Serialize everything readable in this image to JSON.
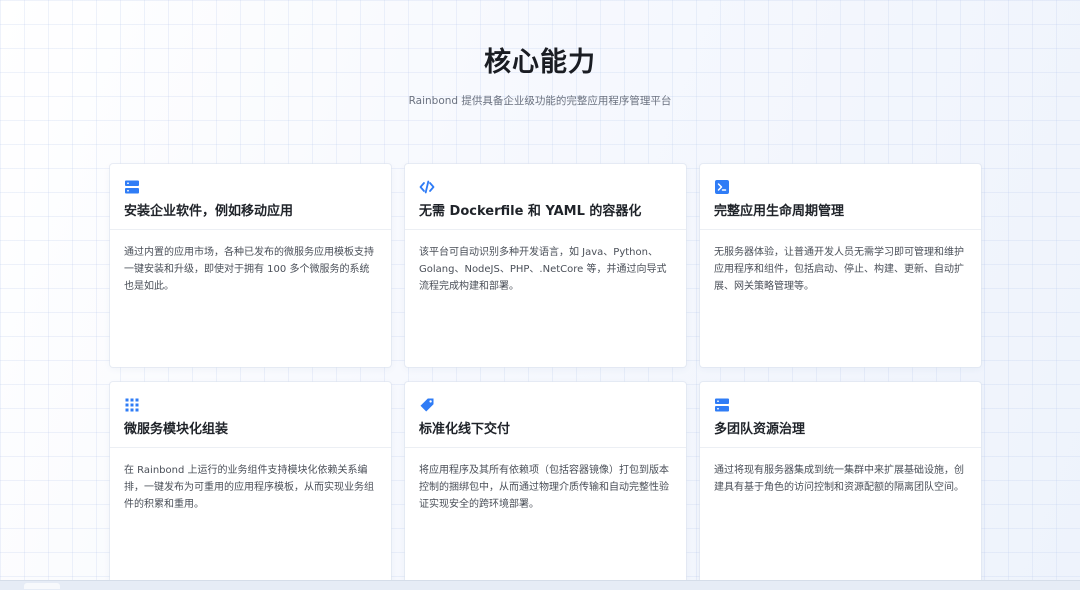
{
  "header": {
    "title": "核心能力",
    "subtitle": "Rainbond 提供具备企业级功能的完整应用程序管理平台"
  },
  "colors": {
    "accent": "#2f7cf6",
    "title_text": "#1a1d23",
    "body_text": "#4a4f58",
    "subtitle_text": "#6b7280"
  },
  "features": [
    {
      "icon": "server-icon",
      "title": "安装企业软件，例如移动应用",
      "description": "通过内置的应用市场，各种已发布的微服务应用模板支持一键安装和升级，即使对于拥有 100 多个微服务的系统也是如此。"
    },
    {
      "icon": "code-icon",
      "title": "无需 Dockerfile 和 YAML 的容器化",
      "description": "该平台可自动识别多种开发语言，如 Java、Python、Golang、NodeJS、PHP、.NetCore 等，并通过向导式流程完成构建和部署。"
    },
    {
      "icon": "terminal-icon",
      "title": "完整应用生命周期管理",
      "description": "无服务器体验，让普通开发人员无需学习即可管理和维护应用程序和组件，包括启动、停止、构建、更新、自动扩展、网关策略管理等。"
    },
    {
      "icon": "grid-icon",
      "title": "微服务模块化组装",
      "description": "在 Rainbond 上运行的业务组件支持模块化依赖关系编排，一键发布为可重用的应用程序模板，从而实现业务组件的积累和重用。"
    },
    {
      "icon": "tag-icon",
      "title": "标准化线下交付",
      "description": "将应用程序及其所有依赖项（包括容器镜像）打包到版本控制的捆绑包中，从而通过物理介质传输和自动完整性验证实现安全的跨环境部署。"
    },
    {
      "icon": "server-icon",
      "title": "多团队资源治理",
      "description": "通过将现有服务器集成到统一集群中来扩展基础设施，创建具有基于角色的访问控制和资源配额的隔离团队空间。"
    }
  ]
}
